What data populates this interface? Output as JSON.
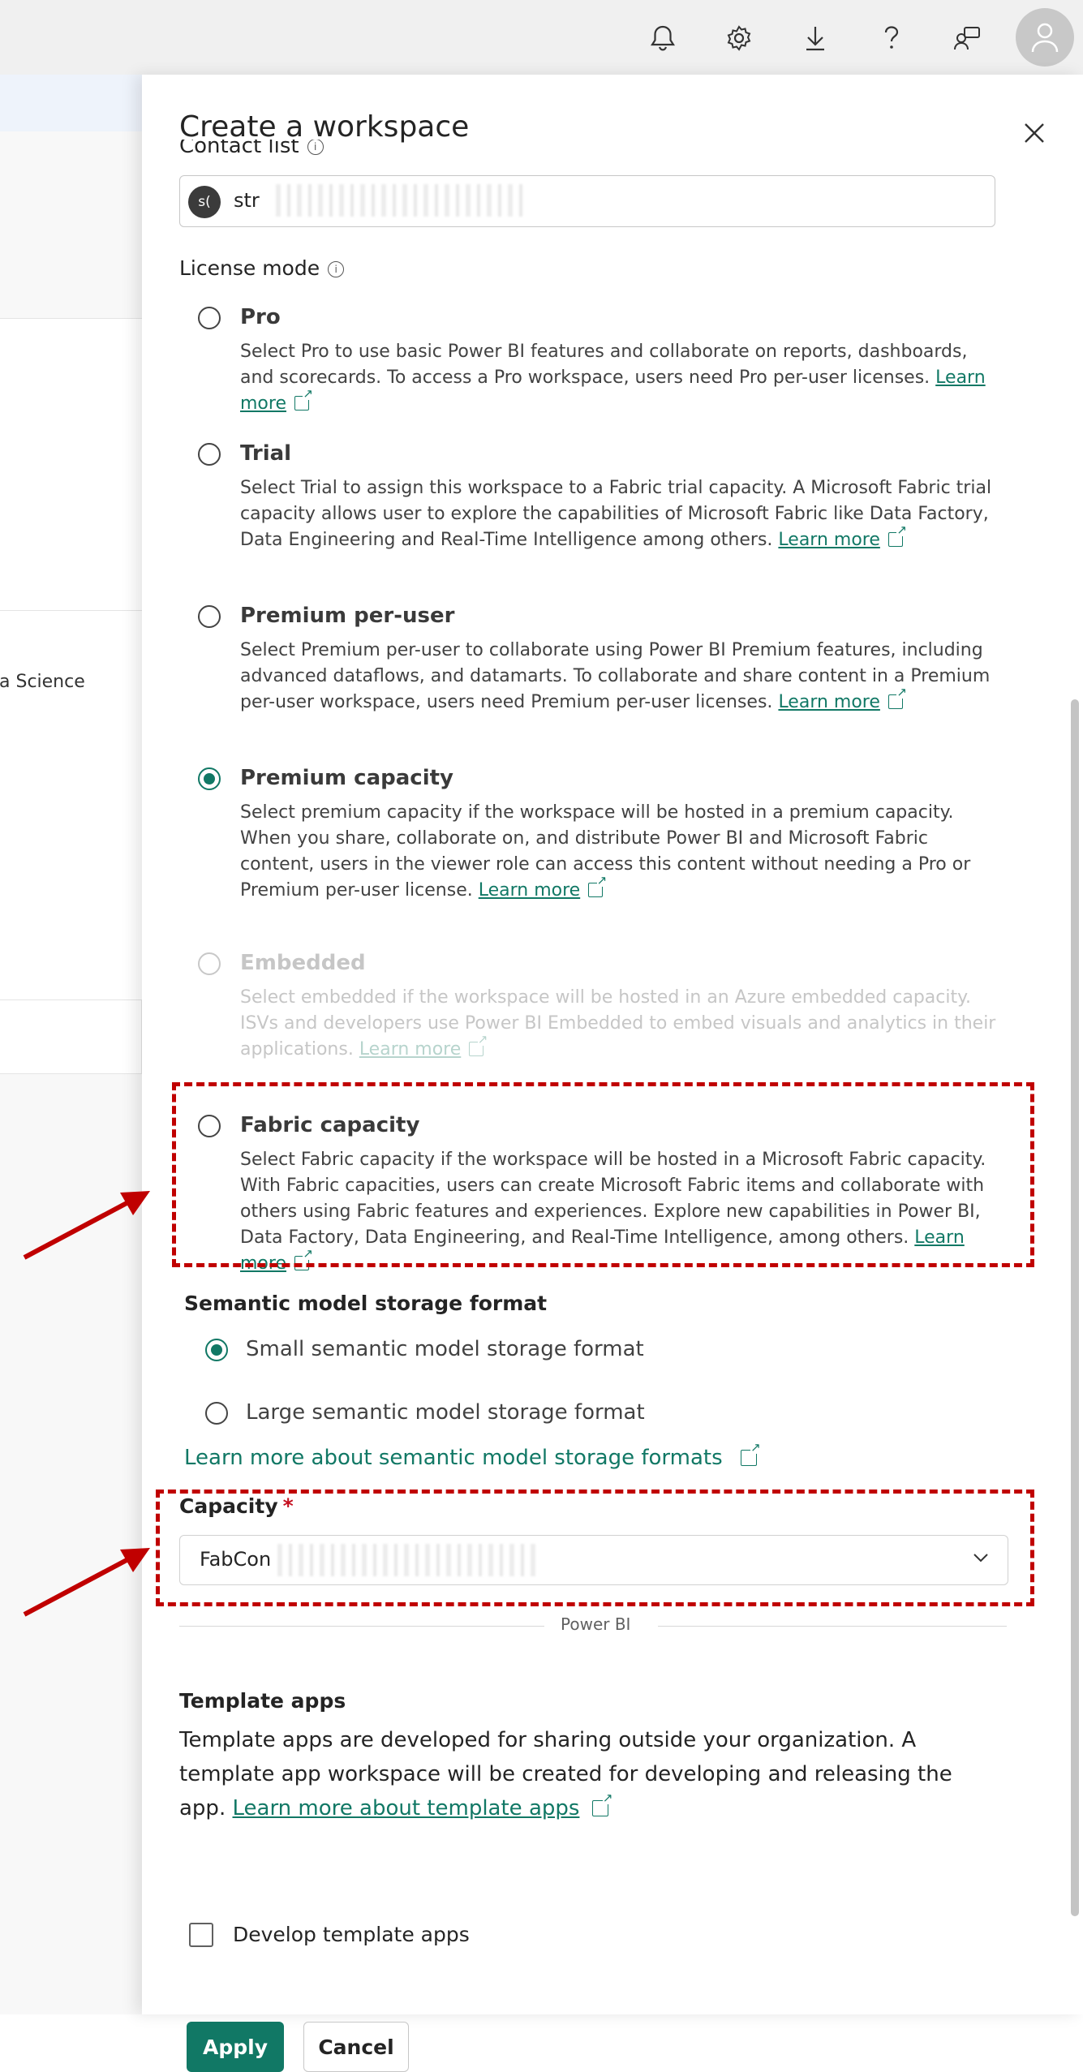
{
  "topbar": {
    "icons": [
      "bell-icon",
      "gear-icon",
      "download-icon",
      "help-icon",
      "share-feedback-icon",
      "user-avatar-icon"
    ]
  },
  "background": {
    "card_text": "a Science"
  },
  "panel": {
    "title": "Create a workspace",
    "contact_list": {
      "label": "Contact list",
      "info": "i",
      "chip_initials": "s(",
      "chip_text": "str"
    },
    "license_mode": {
      "label": "License mode",
      "info": "i",
      "options": [
        {
          "title": "Pro",
          "desc": "Select Pro to use basic Power BI features and collaborate on reports, dashboards, and scorecards. To access a Pro workspace, users need Pro per-user licenses.",
          "link": "Learn more",
          "state": "unchecked"
        },
        {
          "title": "Trial",
          "desc": "Select Trial to assign this workspace to a Fabric trial capacity. A Microsoft Fabric trial capacity allows user to explore the capabilities of Microsoft Fabric like Data Factory, Data Engineering and Real-Time Intelligence among others.",
          "link": "Learn more",
          "state": "unchecked"
        },
        {
          "title": "Premium per-user",
          "desc": "Select Premium per-user to collaborate using Power BI Premium features, including advanced dataflows, and datamarts. To collaborate and share content in a Premium per-user workspace, users need Premium per-user licenses.",
          "link": "Learn more",
          "state": "unchecked"
        },
        {
          "title": "Premium capacity",
          "desc": "Select premium capacity if the workspace will be hosted in a premium capacity. When you share, collaborate on, and distribute Power BI and Microsoft Fabric content, users in the viewer role can access this content without needing a Pro or Premium per-user license.",
          "link": "Learn more",
          "state": "checked"
        },
        {
          "title": "Embedded",
          "desc": "Select embedded if the workspace will be hosted in an Azure embedded capacity. ISVs and developers use Power BI Embedded to embed visuals and analytics in their applications.",
          "link": "Learn more",
          "state": "disabled"
        },
        {
          "title": "Fabric capacity",
          "desc": "Select Fabric capacity if the workspace will be hosted in a Microsoft Fabric capacity. With Fabric capacities, users can create Microsoft Fabric items and collaborate with others using Fabric features and experiences. Explore new capabilities in Power BI, Data Factory, Data Engineering, and Real-Time Intelligence, among others.",
          "link": "Learn more",
          "state": "unchecked"
        }
      ]
    },
    "semantic_model": {
      "label": "Semantic model storage format",
      "small": "Small semantic model storage format",
      "large": "Large semantic model storage format",
      "selected": "small",
      "learn_more": "Learn more about semantic model storage formats"
    },
    "capacity": {
      "label": "Capacity",
      "required_mark": "*",
      "value": "FabCon"
    },
    "divider_text": "Power BI",
    "template_apps": {
      "title": "Template apps",
      "desc": "Template apps are developed for sharing outside your organization. A template app workspace will be created for developing and releasing the app.",
      "link_text": "Learn more about template apps",
      "checkbox_label": "Develop template apps",
      "checked": false
    },
    "buttons": {
      "apply": "Apply",
      "cancel": "Cancel"
    }
  },
  "colors": {
    "accent": "#117865",
    "highlight": "#C00000",
    "required": "#C50F1F"
  }
}
